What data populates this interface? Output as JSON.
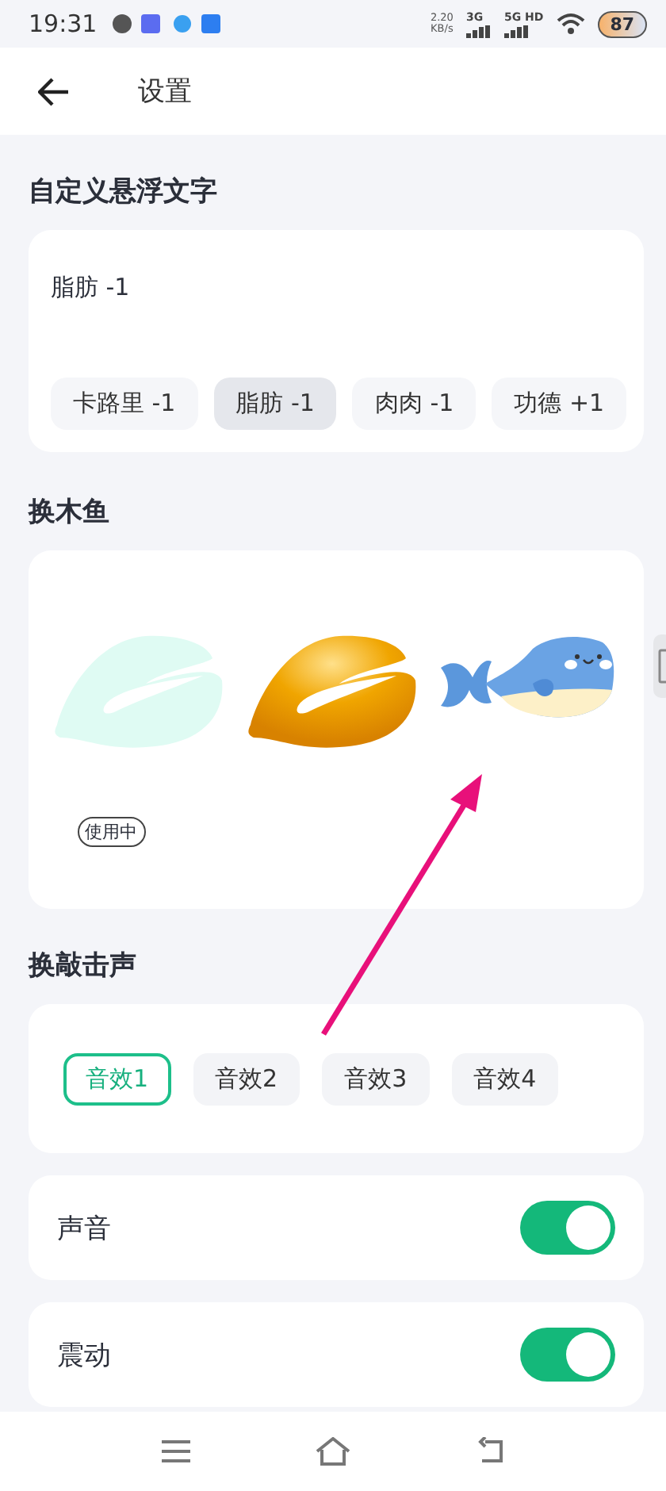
{
  "status_bar": {
    "time": "19:31",
    "net_speed": "2.20",
    "net_unit": "KB/s",
    "sim1": "3G",
    "sim2": "5G HD",
    "battery": "87"
  },
  "header": {
    "title": "设置"
  },
  "float_text": {
    "title": "自定义悬浮文字",
    "current": "脂肪 -1",
    "chips": [
      {
        "label": "卡路里 -1",
        "selected": false
      },
      {
        "label": "脂肪 -1",
        "selected": true
      },
      {
        "label": "肉肉 -1",
        "selected": false
      },
      {
        "label": "功德 +1",
        "selected": false
      }
    ]
  },
  "fish": {
    "title": "换木鱼",
    "in_use_label": "使用中",
    "items": [
      {
        "kind": "mint",
        "in_use": true
      },
      {
        "kind": "gold",
        "in_use": false
      },
      {
        "kind": "whale",
        "in_use": false
      }
    ]
  },
  "sounds": {
    "title": "换敲击声",
    "items": [
      {
        "label": "音效1",
        "selected": true
      },
      {
        "label": "音效2",
        "selected": false
      },
      {
        "label": "音效3",
        "selected": false
      },
      {
        "label": "音效4",
        "selected": false
      }
    ]
  },
  "toggles": [
    {
      "label": "声音",
      "on": true
    },
    {
      "label": "震动",
      "on": true
    }
  ]
}
